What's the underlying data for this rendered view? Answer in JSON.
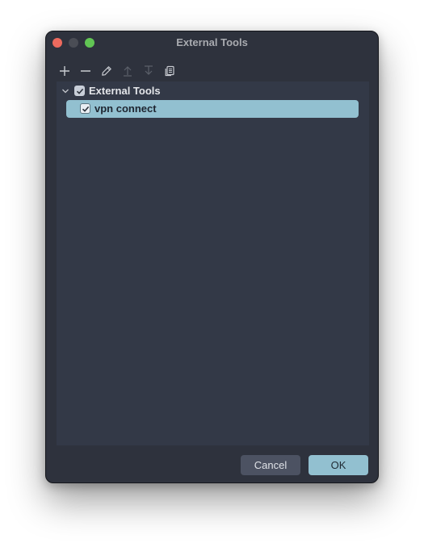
{
  "window": {
    "title": "External Tools"
  },
  "toolbar": {
    "buttons": [
      {
        "icon": "plus-icon",
        "enabled": true
      },
      {
        "icon": "minus-icon",
        "enabled": true
      },
      {
        "icon": "pencil-icon",
        "enabled": true
      },
      {
        "icon": "arrow-up-icon",
        "enabled": false
      },
      {
        "icon": "arrow-down-icon",
        "enabled": false
      },
      {
        "icon": "copy-icon",
        "enabled": true
      }
    ]
  },
  "tree": {
    "group": {
      "label": "External Tools",
      "checked": true,
      "expanded": true
    },
    "items": [
      {
        "label": "vpn connect",
        "checked": true,
        "selected": true
      }
    ]
  },
  "footer": {
    "cancel_label": "Cancel",
    "ok_label": "OK"
  },
  "colors": {
    "window_bg": "#2e323d",
    "panel_bg": "#333947",
    "accent": "#92c0d0",
    "close": "#ed6a5e",
    "minimize": "#4a4d55",
    "maximize": "#61c554"
  }
}
